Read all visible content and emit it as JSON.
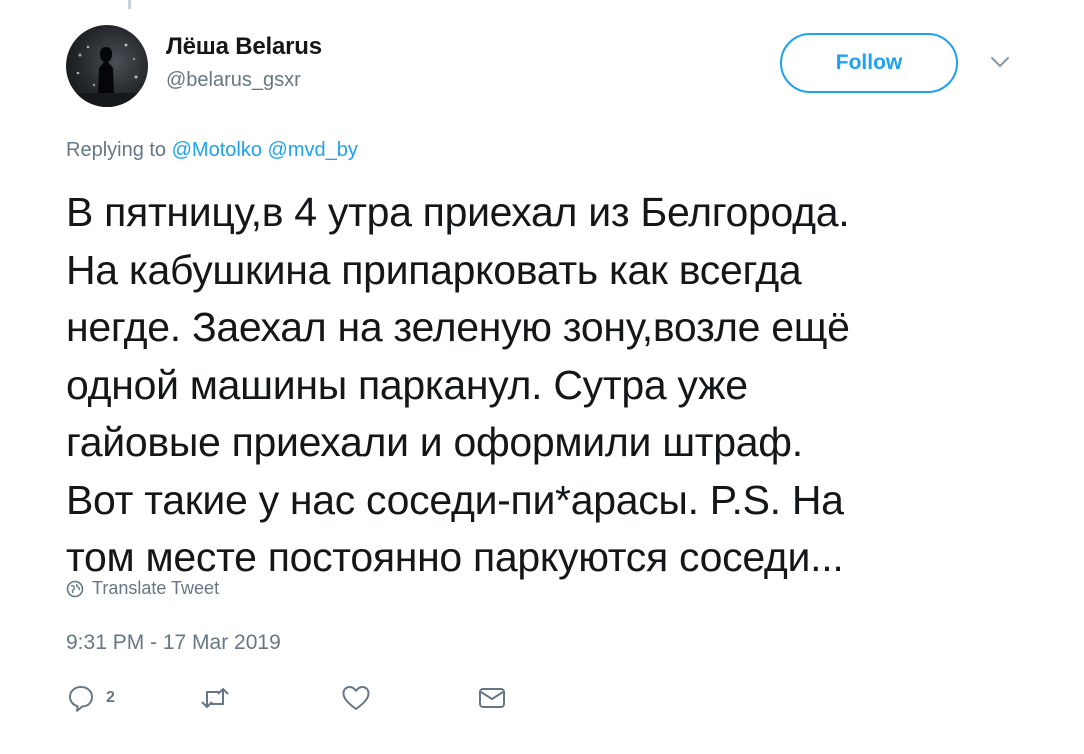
{
  "tweet": {
    "author": {
      "display_name": "Лёша Belarus",
      "handle": "@belarus_gsxr"
    },
    "follow_label": "Follow",
    "replying": {
      "prefix": "Replying to",
      "mentions": [
        "@Motolko",
        "@mvd_by"
      ]
    },
    "text_lines": [
      "В пятницу,в 4 утра приехал из Белгорода.",
      "На кабушкина припарковать как всегда",
      "негде. Заехал на зеленую зону,возле ещё",
      "одной машины парканул.  Сутра уже",
      "гайовые приехали и оформили штраф.",
      "Вот такие у нас соседи-пи*арасы. P.S. На",
      "том месте постоянно паркуются соседи..."
    ],
    "translate_label": "Translate Tweet",
    "timestamp": "9:31 PM - 17 Mar 2019",
    "actions": {
      "reply": {
        "icon": "reply-icon",
        "count": "2"
      },
      "retweet": {
        "icon": "retweet-icon"
      },
      "like": {
        "icon": "heart-icon"
      },
      "dm": {
        "icon": "envelope-icon"
      }
    }
  },
  "colors": {
    "accent": "#1da1f2",
    "text": "#14171a",
    "secondary": "#657786",
    "thread_line": "#c4d1dc"
  }
}
